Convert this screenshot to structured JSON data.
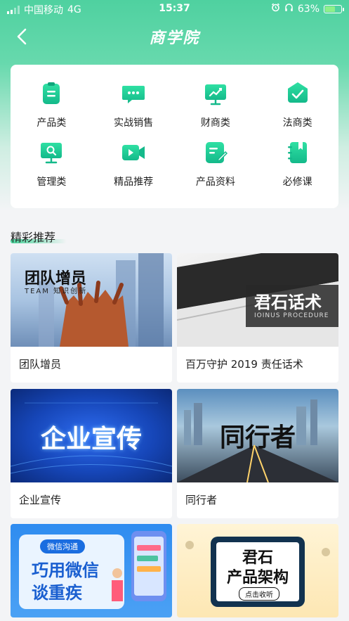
{
  "status_bar": {
    "carrier": "中国移动",
    "network": "4G",
    "time": "15:37",
    "battery": "63%"
  },
  "nav": {
    "title": "商学院"
  },
  "categories": [
    {
      "label": "产品类",
      "icon": "clipboard-icon"
    },
    {
      "label": "实战销售",
      "icon": "chat-bubbles-icon"
    },
    {
      "label": "财商类",
      "icon": "presentation-chart-icon"
    },
    {
      "label": "法商类",
      "icon": "checkmark-badge-icon"
    },
    {
      "label": "管理类",
      "icon": "monitor-search-icon"
    },
    {
      "label": "精品推荐",
      "icon": "video-camera-icon"
    },
    {
      "label": "产品资料",
      "icon": "document-edit-icon"
    },
    {
      "label": "必修课",
      "icon": "notebook-icon"
    }
  ],
  "section": {
    "title": "精彩推荐"
  },
  "courses": [
    {
      "title": "团队增员",
      "thumb_text": "团队增员",
      "thumb_sub": "TEAM 知识创新"
    },
    {
      "title": "百万守护 2019 责任话术",
      "thumb_text": "君石话术",
      "thumb_sub": "IOINUS PROCEDURE"
    },
    {
      "title": "企业宣传",
      "thumb_text": "企业宣传"
    },
    {
      "title": "同行者",
      "thumb_text": "同行者"
    },
    {
      "title": "",
      "thumb_badge": "微信沟通",
      "thumb_text": "巧用微信",
      "thumb_text2": "谈重疾"
    },
    {
      "title": "",
      "thumb_text": "君石",
      "thumb_text2": "产品架构",
      "thumb_badge": "点击收听"
    }
  ],
  "colors": {
    "accent": "#47d39a",
    "icon_gradient_top": "#2fe0a3",
    "icon_gradient_bottom": "#14b98a"
  }
}
